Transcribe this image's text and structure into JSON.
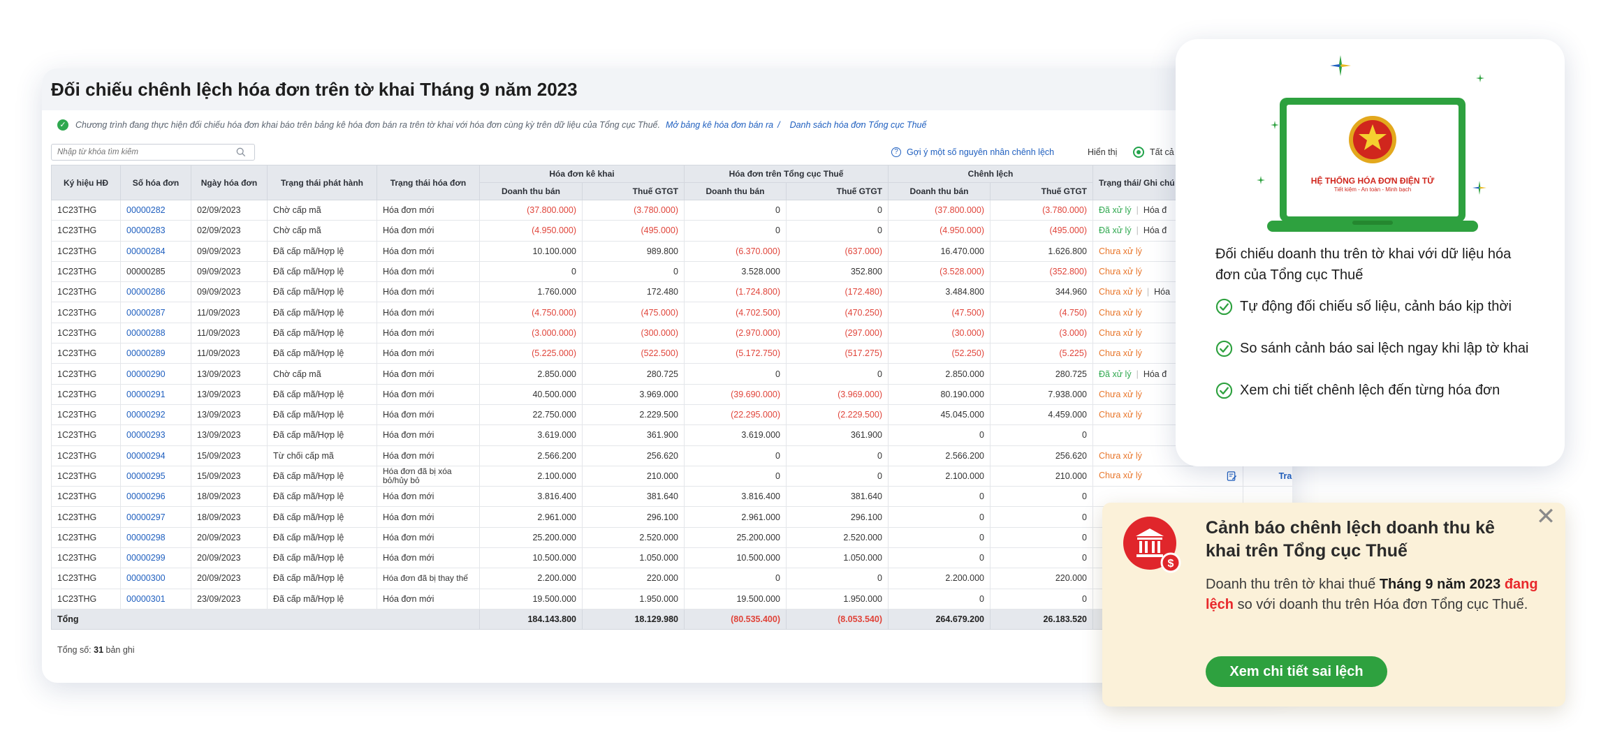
{
  "report": {
    "title": "Đối chiếu chênh lệch hóa đơn trên tờ khai Tháng 9 năm 2023",
    "notice": "Chương trình đang thực hiện đối chiếu hóa đơn khai báo trên bảng kê hóa đơn bán ra trên tờ khai với hóa đơn cùng kỳ trên dữ liệu của Tổng cục Thuế.",
    "link_sales_list": "Mở bảng kê hóa đơn bán ra",
    "link_separator": "/",
    "link_tax_list": "Danh sách hóa đơn Tổng cục Thuế",
    "search_placeholder": "Nhập từ khóa tìm kiếm",
    "hint_link": "Gợi ý một số nguyên nhân chênh lệch",
    "display_label": "Hiển thị",
    "display_option": "Tất cả",
    "record_count_label": "Tổng số:",
    "record_count_value": "31",
    "record_count_unit": "bản ghi",
    "columns": {
      "symbol": "Ký hiệu HĐ",
      "invoice_no": "Số hóa đơn",
      "invoice_date": "Ngày hóa đơn",
      "issue_status": "Trạng thái phát hành",
      "invoice_status": "Trạng thái hóa đơn",
      "group_declared": "Hóa đơn kê khai",
      "group_tax": "Hóa đơn trên Tổng cục Thuế",
      "group_diff": "Chênh lệch",
      "revenue": "Doanh thu bán",
      "vat": "Thuế GTGT",
      "note": "Trạng thái/ Ghi chú"
    },
    "rows": [
      {
        "sym": "1C23THG",
        "no": "00000282",
        "link": true,
        "date": "02/09/2023",
        "issue": "Chờ cấp mã",
        "status": "Hóa đơn mới",
        "d_rev": "(37.800.000)",
        "d_vat": "(3.780.000)",
        "t_rev": "0",
        "t_vat": "0",
        "c_rev": "(37.800.000)",
        "c_vat": "(3.780.000)",
        "note": "Đã xử lý",
        "note_type": "done",
        "note2": "Hóa đ"
      },
      {
        "sym": "1C23THG",
        "no": "00000283",
        "link": true,
        "date": "02/09/2023",
        "issue": "Chờ cấp mã",
        "status": "Hóa đơn mới",
        "d_rev": "(4.950.000)",
        "d_vat": "(495.000)",
        "t_rev": "0",
        "t_vat": "0",
        "c_rev": "(4.950.000)",
        "c_vat": "(495.000)",
        "note": "Đã xử lý",
        "note_type": "done",
        "note2": "Hóa đ"
      },
      {
        "sym": "1C23THG",
        "no": "00000284",
        "link": true,
        "date": "09/09/2023",
        "issue": "Đã cấp mã/Hợp lệ",
        "status": "Hóa đơn mới",
        "d_rev": "10.100.000",
        "d_vat": "989.800",
        "t_rev": "(6.370.000)",
        "t_vat": "(637.000)",
        "c_rev": "16.470.000",
        "c_vat": "1.626.800",
        "note": "Chưa xử lý",
        "note_type": "todo"
      },
      {
        "sym": "1C23THG",
        "no": "00000285",
        "link": false,
        "date": "09/09/2023",
        "issue": "Đã cấp mã/Hợp lệ",
        "status": "Hóa đơn mới",
        "d_rev": "0",
        "d_vat": "0",
        "t_rev": "3.528.000",
        "t_vat": "352.800",
        "c_rev": "(3.528.000)",
        "c_vat": "(352.800)",
        "note": "Chưa xử lý",
        "note_type": "todo"
      },
      {
        "sym": "1C23THG",
        "no": "00000286",
        "link": true,
        "date": "09/09/2023",
        "issue": "Đã cấp mã/Hợp lệ",
        "status": "Hóa đơn mới",
        "d_rev": "1.760.000",
        "d_vat": "172.480",
        "t_rev": "(1.724.800)",
        "t_vat": "(172.480)",
        "c_rev": "3.484.800",
        "c_vat": "344.960",
        "note": "Chưa xử lý",
        "note_type": "todo",
        "note2": "Hóa"
      },
      {
        "sym": "1C23THG",
        "no": "00000287",
        "link": true,
        "date": "11/09/2023",
        "issue": "Đã cấp mã/Hợp lệ",
        "status": "Hóa đơn mới",
        "d_rev": "(4.750.000)",
        "d_vat": "(475.000)",
        "t_rev": "(4.702.500)",
        "t_vat": "(470.250)",
        "c_rev": "(47.500)",
        "c_vat": "(4.750)",
        "note": "Chưa xử lý",
        "note_type": "todo"
      },
      {
        "sym": "1C23THG",
        "no": "00000288",
        "link": true,
        "date": "11/09/2023",
        "issue": "Đã cấp mã/Hợp lệ",
        "status": "Hóa đơn mới",
        "d_rev": "(3.000.000)",
        "d_vat": "(300.000)",
        "t_rev": "(2.970.000)",
        "t_vat": "(297.000)",
        "c_rev": "(30.000)",
        "c_vat": "(3.000)",
        "note": "Chưa xử lý",
        "note_type": "todo"
      },
      {
        "sym": "1C23THG",
        "no": "00000289",
        "link": true,
        "date": "11/09/2023",
        "issue": "Đã cấp mã/Hợp lệ",
        "status": "Hóa đơn mới",
        "d_rev": "(5.225.000)",
        "d_vat": "(522.500)",
        "t_rev": "(5.172.750)",
        "t_vat": "(517.275)",
        "c_rev": "(52.250)",
        "c_vat": "(5.225)",
        "note": "Chưa xử lý",
        "note_type": "todo"
      },
      {
        "sym": "1C23THG",
        "no": "00000290",
        "link": true,
        "date": "13/09/2023",
        "issue": "Chờ cấp mã",
        "status": "Hóa đơn mới",
        "d_rev": "2.850.000",
        "d_vat": "280.725",
        "t_rev": "0",
        "t_vat": "0",
        "c_rev": "2.850.000",
        "c_vat": "280.725",
        "note": "Đã xử lý",
        "note_type": "done",
        "note2": "Hóa đ"
      },
      {
        "sym": "1C23THG",
        "no": "00000291",
        "link": true,
        "date": "13/09/2023",
        "issue": "Đã cấp mã/Hợp lệ",
        "status": "Hóa đơn mới",
        "d_rev": "40.500.000",
        "d_vat": "3.969.000",
        "t_rev": "(39.690.000)",
        "t_vat": "(3.969.000)",
        "c_rev": "80.190.000",
        "c_vat": "7.938.000",
        "note": "Chưa xử lý",
        "note_type": "todo"
      },
      {
        "sym": "1C23THG",
        "no": "00000292",
        "link": true,
        "date": "13/09/2023",
        "issue": "Đã cấp mã/Hợp lệ",
        "status": "Hóa đơn mới",
        "d_rev": "22.750.000",
        "d_vat": "2.229.500",
        "t_rev": "(22.295.000)",
        "t_vat": "(2.229.500)",
        "c_rev": "45.045.000",
        "c_vat": "4.459.000",
        "note": "Chưa xử lý",
        "note_type": "todo"
      },
      {
        "sym": "1C23THG",
        "no": "00000293",
        "link": true,
        "date": "13/09/2023",
        "issue": "Đã cấp mã/Hợp lệ",
        "status": "Hóa đơn mới",
        "d_rev": "3.619.000",
        "d_vat": "361.900",
        "t_rev": "3.619.000",
        "t_vat": "361.900",
        "c_rev": "0",
        "c_vat": "0",
        "note": "",
        "note_type": "none"
      },
      {
        "sym": "1C23THG",
        "no": "00000294",
        "link": true,
        "date": "15/09/2023",
        "issue": "Từ chối cấp mã",
        "status": "Hóa đơn mới",
        "d_rev": "2.566.200",
        "d_vat": "256.620",
        "t_rev": "0",
        "t_vat": "0",
        "c_rev": "2.566.200",
        "c_vat": "256.620",
        "note": "Chưa xử lý",
        "note_type": "todo"
      },
      {
        "sym": "1C23THG",
        "no": "00000295",
        "link": true,
        "date": "15/09/2023",
        "issue": "Đã cấp mã/Hợp lệ",
        "status": "Hóa đơn đã bị xóa bỏ/hủy bỏ",
        "d_rev": "2.100.000",
        "d_vat": "210.000",
        "t_rev": "0",
        "t_vat": "0",
        "c_rev": "2.100.000",
        "c_vat": "210.000",
        "note": "Chưa xử lý",
        "note_type": "todo",
        "lookup": "Tra cứu"
      },
      {
        "sym": "1C23THG",
        "no": "00000296",
        "link": true,
        "date": "18/09/2023",
        "issue": "Đã cấp mã/Hợp lệ",
        "status": "Hóa đơn mới",
        "d_rev": "3.816.400",
        "d_vat": "381.640",
        "t_rev": "3.816.400",
        "t_vat": "381.640",
        "c_rev": "0",
        "c_vat": "0",
        "note": "",
        "note_type": "none"
      },
      {
        "sym": "1C23THG",
        "no": "00000297",
        "link": true,
        "date": "18/09/2023",
        "issue": "Đã cấp mã/Hợp lệ",
        "status": "Hóa đơn mới",
        "d_rev": "2.961.000",
        "d_vat": "296.100",
        "t_rev": "2.961.000",
        "t_vat": "296.100",
        "c_rev": "0",
        "c_vat": "0",
        "note": "",
        "note_type": "none"
      },
      {
        "sym": "1C23THG",
        "no": "00000298",
        "link": true,
        "date": "20/09/2023",
        "issue": "Đã cấp mã/Hợp lệ",
        "status": "Hóa đơn mới",
        "d_rev": "25.200.000",
        "d_vat": "2.520.000",
        "t_rev": "25.200.000",
        "t_vat": "2.520.000",
        "c_rev": "0",
        "c_vat": "0",
        "note": "",
        "note_type": "none"
      },
      {
        "sym": "1C23THG",
        "no": "00000299",
        "link": true,
        "date": "20/09/2023",
        "issue": "Đã cấp mã/Hợp lệ",
        "status": "Hóa đơn mới",
        "d_rev": "10.500.000",
        "d_vat": "1.050.000",
        "t_rev": "10.500.000",
        "t_vat": "1.050.000",
        "c_rev": "0",
        "c_vat": "0",
        "note": "",
        "note_type": "none"
      },
      {
        "sym": "1C23THG",
        "no": "00000300",
        "link": true,
        "date": "20/09/2023",
        "issue": "Đã cấp mã/Hợp lệ",
        "status": "Hóa đơn đã bị thay thế",
        "d_rev": "2.200.000",
        "d_vat": "220.000",
        "t_rev": "0",
        "t_vat": "0",
        "c_rev": "2.200.000",
        "c_vat": "220.000",
        "note": "",
        "note_type": "none"
      },
      {
        "sym": "1C23THG",
        "no": "00000301",
        "link": true,
        "date": "23/09/2023",
        "issue": "Đã cấp mã/Hợp lệ",
        "status": "Hóa đơn mới",
        "d_rev": "19.500.000",
        "d_vat": "1.950.000",
        "t_rev": "19.500.000",
        "t_vat": "1.950.000",
        "c_rev": "0",
        "c_vat": "0",
        "note": "",
        "note_type": "none"
      }
    ],
    "total": {
      "label": "Tổng",
      "d_rev": "184.143.800",
      "d_vat": "18.129.980",
      "t_rev": "(80.535.400)",
      "t_vat": "(8.053.540)",
      "c_rev": "264.679.200",
      "c_vat": "26.183.520"
    }
  },
  "info_card": {
    "laptop_screen_title": "HỆ THỐNG HÓA ĐƠN ĐIỆN TỬ",
    "laptop_screen_subtitle": "Tiết kiệm - An toàn - Minh bạch",
    "heading": "Đối chiếu doanh thu trên tờ khai với dữ liệu hóa đơn của Tổng cục Thuế",
    "features": [
      "Tự động đối chiếu số liệu, cảnh báo kịp thời",
      "So sánh cảnh báo sai lệch ngay khi lập tờ khai",
      "Xem chi tiết chênh lệch đến từng hóa đơn"
    ]
  },
  "alert": {
    "title": "Cảnh báo chênh lệch doanh thu kê khai trên Tổng cục Thuế",
    "body_prefix": "Doanh thu trên tờ khai thuế",
    "body_period": "Tháng 9 năm 2023",
    "body_highlight": "đang lệch",
    "body_suffix": "so với doanh thu trên Hóa đơn Tổng cục Thuế.",
    "button": "Xem chi tiết sai lệch",
    "close_symbol": "✕"
  },
  "colors": {
    "accent_green": "#2ea13f",
    "link_blue": "#1f5fbf",
    "negative_red": "#e0443a",
    "pending_orange": "#e8762b",
    "alert_bg": "#fbf1d9"
  }
}
